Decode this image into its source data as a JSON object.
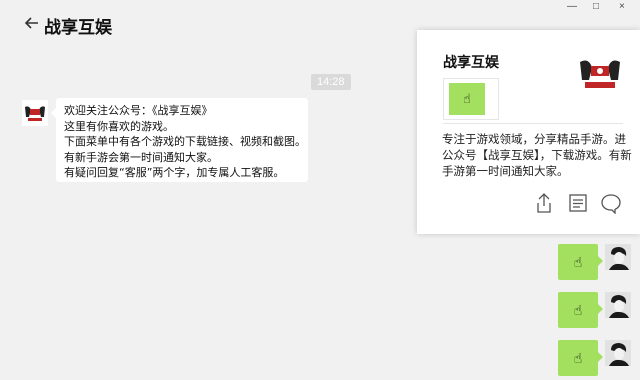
{
  "window": {
    "title": "战享互娱",
    "controls": [
      "—",
      "□",
      "×"
    ]
  },
  "chat": {
    "timestamp": "14:28",
    "incoming": {
      "lines": [
        "欢迎关注公众号：《战享互娱》",
        "这里有你喜欢的游戏。",
        "下面菜单中有各个游戏的下载链接、视频和截图。",
        "有新手游会第一时间通知大家。",
        "有疑问回复“客服”两个字，加专属人工客服。"
      ]
    },
    "outgoing": [
      {
        "emoji": "☝"
      },
      {
        "emoji": "☝"
      },
      {
        "emoji": "☝"
      }
    ]
  },
  "card": {
    "name": "战享互娱",
    "description": "专注于游戏领域，分享精品手游。进公众号【战享互娱】，下载游戏。有新手游第一时间通知大家。",
    "thumb_emoji": "☝",
    "icons": [
      "share-icon",
      "document-icon",
      "chat-bubble-icon"
    ]
  },
  "colors": {
    "background": "#f1f1f1",
    "bubble_green": "#a3e05f",
    "timestamp_bg": "#dadada"
  }
}
